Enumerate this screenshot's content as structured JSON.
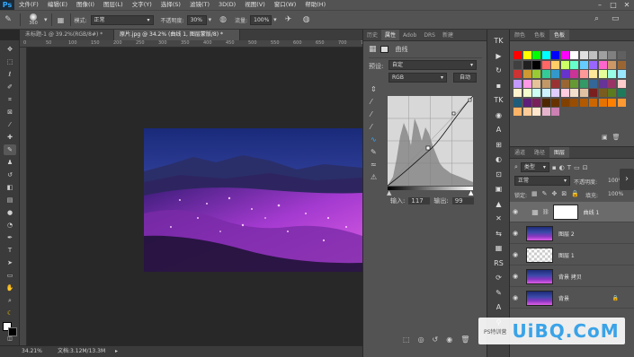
{
  "app": {
    "logo": "Ps"
  },
  "menu": [
    "文件(F)",
    "编辑(E)",
    "图像(I)",
    "图层(L)",
    "文字(Y)",
    "选择(S)",
    "滤镜(T)",
    "3D(D)",
    "视图(V)",
    "窗口(W)",
    "帮助(H)"
  ],
  "options_bar": {
    "brush_size": "360",
    "mode_label": "模式:",
    "mode_value": "正常",
    "opacity_label": "不透明度:",
    "opacity_value": "30%",
    "flow_label": "流量:",
    "flow_value": "100%"
  },
  "doc_tabs": [
    {
      "label": "未标题-1 @ 39.2%(RGB/8#) *",
      "active": false
    },
    {
      "label": "原片.jpg @ 34.2% (曲线 1, 图层蒙版/8) *",
      "active": true
    }
  ],
  "ruler_ticks": [
    "0",
    "50",
    "100",
    "150",
    "200",
    "250",
    "300",
    "350",
    "400",
    "450",
    "500",
    "550",
    "600",
    "650",
    "700",
    "750"
  ],
  "status": {
    "zoom": "34.21%",
    "doc": "文档:3.12M/13.3M"
  },
  "properties": {
    "tabs": [
      "历史",
      "属性",
      "Adob",
      "DRS",
      "新建"
    ],
    "active_tab": 1,
    "title": "曲线",
    "preset_label": "预设:",
    "preset_value": "自定",
    "channel_value": "RGB",
    "auto_button": "自动",
    "input_label": "输入:",
    "input_value": "117",
    "output_label": "输出:",
    "output_value": "99"
  },
  "swatches_panel": {
    "tabs": [
      "颜色",
      "色板",
      "色板"
    ],
    "active_tab": 2
  },
  "layers_panel": {
    "tabs": [
      "通道",
      "路径",
      "图层"
    ],
    "active_tab": 2,
    "filter_kind": "类型",
    "blend_mode": "正常",
    "opacity_label": "不透明度:",
    "opacity_value": "100%",
    "lock_label": "锁定:",
    "fill_label": "填充:",
    "fill_value": "100%",
    "layers": [
      {
        "name": "曲线 1",
        "selected": true,
        "thumb": "adjust"
      },
      {
        "name": "图层 2",
        "selected": false,
        "thumb": "photo"
      },
      {
        "name": "图层 1",
        "selected": false,
        "thumb": "transparent"
      },
      {
        "name": "背景 拷贝",
        "selected": false,
        "thumb": "photo"
      },
      {
        "name": "背景",
        "selected": false,
        "thumb": "photo",
        "locked": true
      }
    ]
  },
  "icon_strip": [
    "TK",
    "▶",
    "↻",
    "▪",
    "TK",
    "◉",
    "A",
    "⊞",
    "◐",
    "⊡",
    "▣",
    "▲",
    "✕",
    "⇆",
    "▦",
    "RS",
    "⟳",
    "✎",
    "A",
    "⚲"
  ],
  "watermark": {
    "text": "UiBQ.CoM",
    "sub": "PS特训营"
  },
  "colors": {
    "accent": "#31a8ff",
    "panel": "#535353",
    "dark": "#282828",
    "watermark": "#3aa3e8"
  }
}
